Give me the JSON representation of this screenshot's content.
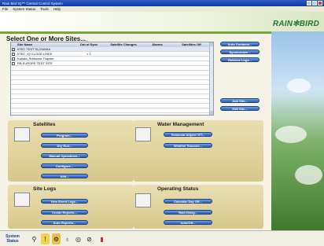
{
  "window": {
    "title": "Rain Bird IQ™ Central Control System"
  },
  "menu": [
    "File",
    "System Status",
    "Tools",
    "Help"
  ],
  "brand": {
    "logo_text": "RAIN✻BIRD",
    "accent": "#1f7a2e"
  },
  "sites": {
    "title": "Select One or More Sites...",
    "columns": [
      "Site Name",
      "Out of Sync",
      "Satellite Changes",
      "Alarms",
      "Satellites Off"
    ],
    "rows": [
      {
        "checked": true,
        "name": "IITEC TEST SLOVAKIA",
        "sync": "",
        "changes": "",
        "alarms": "",
        "off": ""
      },
      {
        "checked": false,
        "name": "IITEC_IQ CLOUD LINKE",
        "sync": "1",
        "changes": "",
        "alarms": "",
        "off": ""
      },
      {
        "checked": false,
        "name": "Kubala_Srekovce-Trapner",
        "sync": "",
        "changes": "",
        "alarms": "",
        "off": ""
      },
      {
        "checked": false,
        "name": "RB EUROPE TEST SITE",
        "sync": "",
        "changes": "",
        "alarms": "",
        "off": ""
      }
    ],
    "side_buttons": [
      "Auto Contacts...",
      "Synchronize...",
      "Retrieve Logs..."
    ],
    "bottom_buttons": [
      "Add Site...",
      "Edit Site..."
    ]
  },
  "satellites": {
    "title": "Satellites",
    "buttons": [
      "Program...",
      "Dry Run...",
      "Manual Operations...",
      "Configure...",
      "Add..."
    ]
  },
  "water": {
    "title": "Water Management",
    "buttons": [
      "Seasonal Adjust / ET...",
      "Weather Sources..."
    ]
  },
  "logs": {
    "title": "Site Logs",
    "buttons": [
      "New Event Logs...",
      "Create Reports...",
      "Auto Reports..."
    ]
  },
  "operating": {
    "title": "Operating Status",
    "buttons": [
      "Calendar Day Off...",
      "Rain Delay...",
      "Auto/Off..."
    ]
  },
  "statusbar": {
    "label_line1": "System",
    "label_line2": "Status"
  }
}
